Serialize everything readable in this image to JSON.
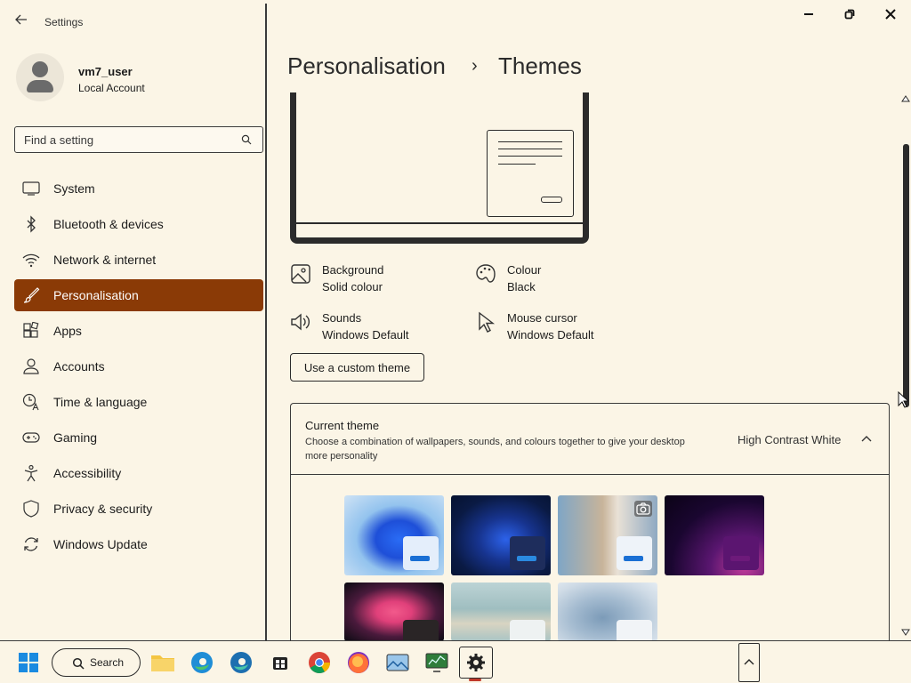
{
  "window": {
    "title": "Settings",
    "controls": {
      "minimize": "—",
      "restore": "❐",
      "close": "✕"
    }
  },
  "user": {
    "name": "vm7_user",
    "account_type": "Local Account"
  },
  "search": {
    "placeholder": "Find a setting"
  },
  "sidebar": {
    "items": [
      {
        "label": "System",
        "icon": "monitor-icon",
        "active": false
      },
      {
        "label": "Bluetooth & devices",
        "icon": "bluetooth-icon",
        "active": false
      },
      {
        "label": "Network & internet",
        "icon": "wifi-icon",
        "active": false
      },
      {
        "label": "Personalisation",
        "icon": "brush-icon",
        "active": true
      },
      {
        "label": "Apps",
        "icon": "apps-icon",
        "active": false
      },
      {
        "label": "Accounts",
        "icon": "person-icon",
        "active": false
      },
      {
        "label": "Time & language",
        "icon": "clock-globe-icon",
        "active": false
      },
      {
        "label": "Gaming",
        "icon": "gamepad-icon",
        "active": false
      },
      {
        "label": "Accessibility",
        "icon": "accessibility-icon",
        "active": false
      },
      {
        "label": "Privacy & security",
        "icon": "shield-icon",
        "active": false
      },
      {
        "label": "Windows Update",
        "icon": "sync-icon",
        "active": false
      }
    ]
  },
  "breadcrumb": {
    "parent": "Personalisation",
    "separator": "›",
    "current": "Themes"
  },
  "theme_props": {
    "background": {
      "title": "Background",
      "value": "Solid colour"
    },
    "colour": {
      "title": "Colour",
      "value": "Black"
    },
    "sounds": {
      "title": "Sounds",
      "value": "Windows Default"
    },
    "mouse_cursor": {
      "title": "Mouse cursor",
      "value": "Windows Default"
    }
  },
  "custom_theme_button": "Use a custom theme",
  "current_theme": {
    "title": "Current theme",
    "description": "Choose a combination of wallpapers, sounds, and colours together to give your desktop more personality",
    "value": "High Contrast White",
    "expanded": true
  },
  "taskbar": {
    "search_label": "Search"
  },
  "colors": {
    "accent": "#8a3a06",
    "background": "#fbf5e6",
    "text": "#1c1c1c"
  }
}
